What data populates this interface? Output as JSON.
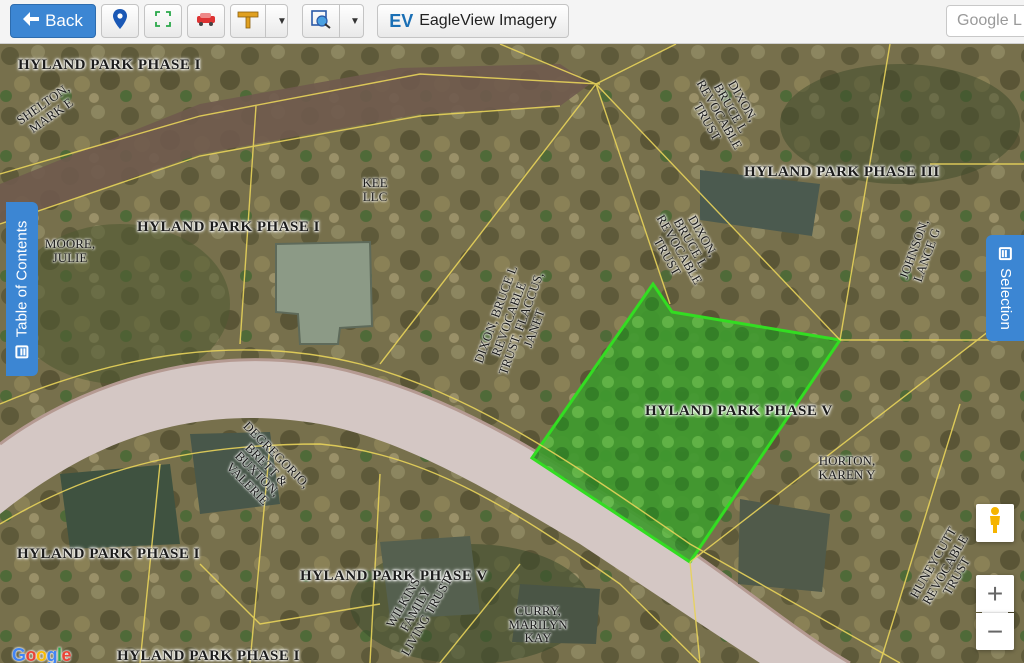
{
  "toolbar": {
    "back_label": "Back",
    "eagleview_label": "EagleView Imagery",
    "eagleview_logo": "EV",
    "search_placeholder": "Google L",
    "icons": [
      "location-pin-icon",
      "fullscreen-icon",
      "car-icon",
      "measure-icon",
      "layers-icon"
    ]
  },
  "side_tabs": {
    "toc_label": "Table of Contents",
    "selection_label": "Selection"
  },
  "map": {
    "subdivision_labels": [
      "HYLAND PARK PHASE I",
      "HYLAND PARK PHASE I",
      "HYLAND PARK PHASE III",
      "HYLAND PARK PHASE V",
      "HYLAND PARK PHASE I",
      "HYLAND PARK PHASE V",
      "HYLAND PARK PHASE I"
    ],
    "owners": [
      "SHELTON, MARK E",
      "KEE LLC",
      "MOORE, JULIE",
      "DIXON, BRUCE L REVOCABLE TRUST",
      "DIXON, BRUCE L REVOCABLE TRUST",
      "JOHNSON, LANCE G",
      "DIXON, BRUCE L REVOCABLE TRUST, FLACCUS, JANET",
      "DEGREGORIO, BRETT & BUXTON, VALERIE",
      "HORTON, KAREN Y",
      "HUNEYCUTT REVOCABLE TRUST",
      "WILKINS FAMILY LIVING TRUST",
      "CURRY, MARILYN KAY"
    ],
    "selected_parcel_color": "#33dd22",
    "parcel_line_color": "#e8d35a"
  },
  "controls": {
    "zoom_in": "+",
    "zoom_out": "−",
    "pegman_icon": "pegman-icon"
  },
  "attribution": {
    "logo": [
      "G",
      "o",
      "o",
      "g",
      "l",
      "e"
    ]
  }
}
